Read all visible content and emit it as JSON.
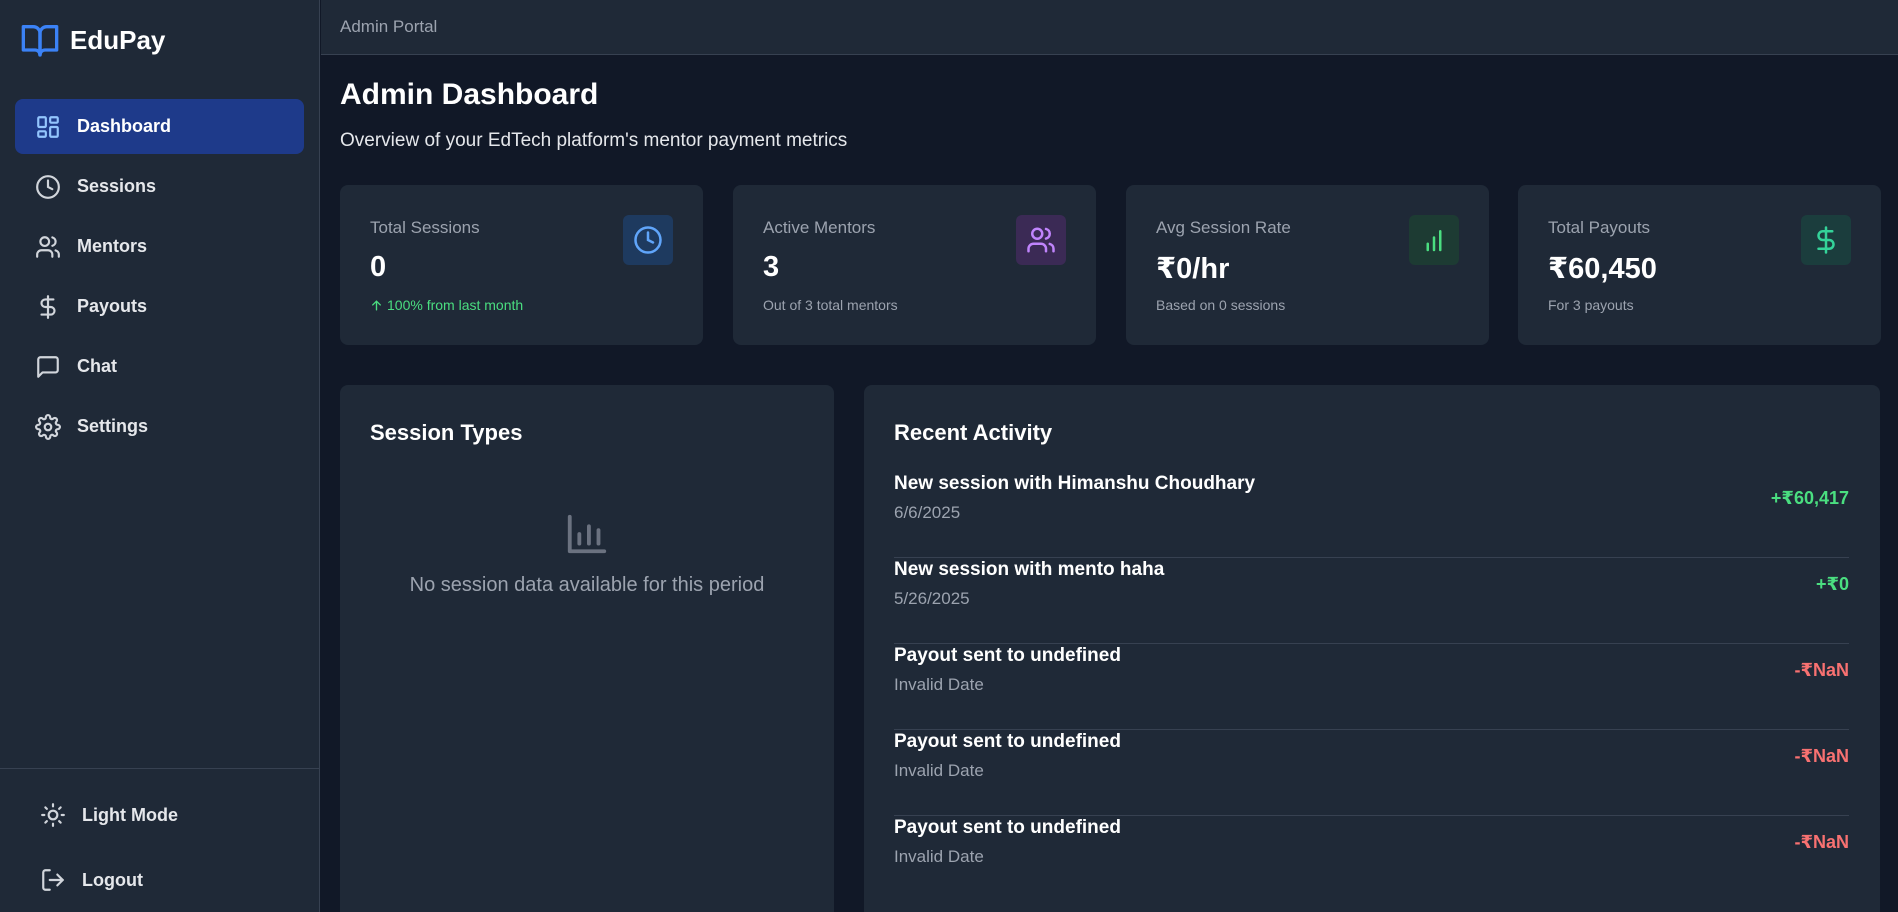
{
  "brand": {
    "name": "EduPay",
    "icon": "open-book-icon",
    "accent": "#3b82f6"
  },
  "sidebar": {
    "items": [
      {
        "label": "Dashboard",
        "icon": "dashboard-grid-icon",
        "active": true
      },
      {
        "label": "Sessions",
        "icon": "clock-icon"
      },
      {
        "label": "Mentors",
        "icon": "users-icon"
      },
      {
        "label": "Payouts",
        "icon": "dollar-icon"
      },
      {
        "label": "Chat",
        "icon": "chat-bubble-icon"
      },
      {
        "label": "Settings",
        "icon": "gear-icon"
      }
    ],
    "bottom": {
      "theme_label": "Light Mode",
      "logout_label": "Logout"
    }
  },
  "topbar": {
    "title": "Admin Portal"
  },
  "page": {
    "title": "Admin Dashboard",
    "subtitle": "Overview of your EdTech platform's mentor payment metrics"
  },
  "stats": [
    {
      "label": "Total Sessions",
      "value": "0",
      "note": "100% from last month",
      "note_positive": true,
      "icon": "clock-icon",
      "icon_color": "#60a5fa",
      "icon_bg": "#1e3a5f"
    },
    {
      "label": "Active Mentors",
      "value": "3",
      "note": "Out of 3 total mentors",
      "icon": "users-icon",
      "icon_color": "#c084fc",
      "icon_bg": "#3b2a55"
    },
    {
      "label": "Avg Session Rate",
      "value": "₹0/hr",
      "note": "Based on 0 sessions",
      "icon": "bar-chart-icon",
      "icon_color": "#4ade80",
      "icon_bg": "#1d3b33"
    },
    {
      "label": "Total Payouts",
      "value": "₹60,450",
      "note": "For 3 payouts",
      "icon": "dollar-icon",
      "icon_color": "#34d399",
      "icon_bg": "#1b3d3d"
    }
  ],
  "session_types": {
    "title": "Session Types",
    "empty_icon": "bar-chart-icon",
    "empty_text": "No session data available for this period"
  },
  "recent_activity": {
    "title": "Recent Activity",
    "items": [
      {
        "title": "New session with Himanshu Choudhary",
        "date": "6/6/2025",
        "amount": "+₹60,417",
        "positive": true
      },
      {
        "title": "New session with mento haha",
        "date": "5/26/2025",
        "amount": "+₹0",
        "positive": true
      },
      {
        "title": "Payout sent to undefined",
        "date": "Invalid Date",
        "amount": "-₹NaN",
        "positive": false
      },
      {
        "title": "Payout sent to undefined",
        "date": "Invalid Date",
        "amount": "-₹NaN",
        "positive": false
      },
      {
        "title": "Payout sent to undefined",
        "date": "Invalid Date",
        "amount": "-₹NaN",
        "positive": false
      }
    ]
  }
}
